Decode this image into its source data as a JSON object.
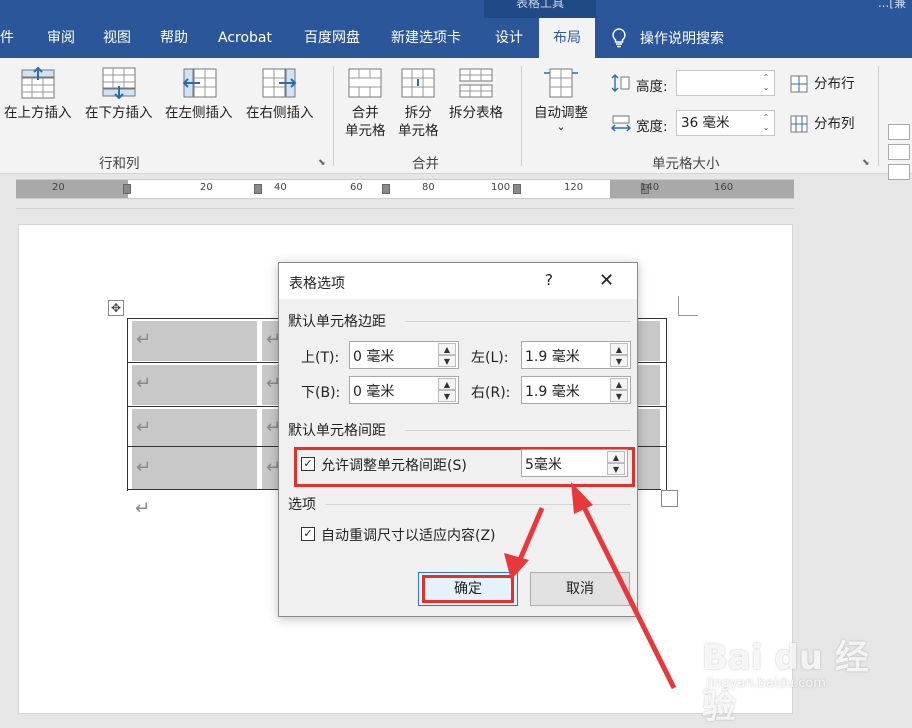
{
  "window": {
    "title_partial": "...[兼",
    "context_group": "表格工具"
  },
  "tabs": [
    {
      "label": "邮件",
      "display": "件"
    },
    {
      "label": "审阅"
    },
    {
      "label": "视图"
    },
    {
      "label": "帮助"
    },
    {
      "label": "Acrobat"
    },
    {
      "label": "百度网盘"
    },
    {
      "label": "新建选项卡"
    },
    {
      "label": "设计"
    },
    {
      "label": "布局"
    }
  ],
  "tell_me": "操作说明搜索",
  "ribbon": {
    "rows_cols": {
      "insert_above": "在上方插入",
      "insert_below": "在下方插入",
      "insert_left": "在左侧插入",
      "insert_right": "在右侧插入",
      "group_label": "行和列"
    },
    "merge": {
      "merge_cells_1": "合并",
      "merge_cells_2": "单元格",
      "split_cells_1": "拆分",
      "split_cells_2": "单元格",
      "split_table": "拆分表格",
      "group_label": "合并"
    },
    "cell_size": {
      "autofit": "自动调整",
      "autofit_caret": "⌄",
      "height_label": "高度:",
      "height_value": "",
      "width_label": "宽度:",
      "width_value": "36 毫米",
      "distribute_rows": "分布行",
      "distribute_cols": "分布列",
      "group_label": "单元格大小"
    }
  },
  "ruler": {
    "numbers": [
      "20",
      "20",
      "40",
      "60",
      "80",
      "100",
      "120",
      "140",
      "160"
    ]
  },
  "dialog": {
    "title": "表格选项",
    "help": "?",
    "close": "✕",
    "margins_section": "默认单元格边距",
    "top_label": "上(T):",
    "top_value": "0 毫米",
    "bottom_label": "下(B):",
    "bottom_value": "0 毫米",
    "left_label": "左(L):",
    "left_value": "1.9 毫米",
    "right_label": "右(R):",
    "right_value": "1.9 毫米",
    "spacing_section": "默认单元格间距",
    "allow_spacing_label": "允许调整单元格间距(S)",
    "allow_spacing_checked": true,
    "spacing_value": "5毫米",
    "options_section": "选项",
    "autofit_label": "自动重调尺寸以适应内容(Z)",
    "autofit_checked": true,
    "ok": "确定",
    "cancel": "取消"
  },
  "watermark": {
    "main": "Bai du 经验",
    "sub": "jingyan.baidu.com"
  },
  "colors": {
    "ribbon_blue": "#2b579a",
    "highlight_red": "#e0312f",
    "arrow_red": "#e8383b"
  }
}
